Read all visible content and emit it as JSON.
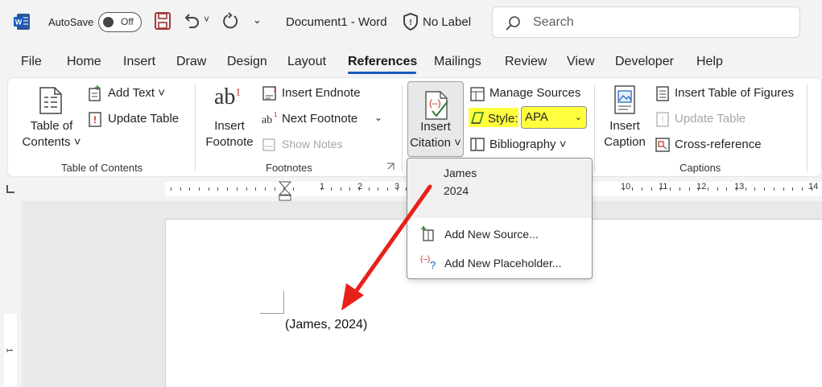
{
  "titlebar": {
    "autosave_label": "AutoSave",
    "autosave_state": "Off",
    "document_title": "Document1  -  Word",
    "label_text": "No Label",
    "search_placeholder": "Search"
  },
  "tabs": [
    "File",
    "Home",
    "Insert",
    "Draw",
    "Design",
    "Layout",
    "References",
    "Mailings",
    "Review",
    "View",
    "Developer",
    "Help"
  ],
  "active_tab": "References",
  "ribbon": {
    "toc": {
      "big_button_line1": "Table of",
      "big_button_line2": "Contents ˅",
      "add_text": "Add Text ˅",
      "update_table": "Update Table",
      "group_label": "Table of Contents"
    },
    "footnotes": {
      "insert_footnote_line1": "Insert",
      "insert_footnote_line2": "Footnote",
      "insert_endnote": "Insert Endnote",
      "next_footnote": "Next Footnote",
      "show_notes": "Show Notes",
      "group_label": "Footnotes",
      "ab_glyph": "ab",
      "sup_glyph": "1"
    },
    "citations": {
      "insert_citation_line1": "Insert",
      "insert_citation_line2": "Citation ˅",
      "manage_sources": "Manage Sources",
      "style_label": "Style:",
      "style_value": "APA",
      "bibliography": "Bibliography ˅"
    },
    "captions": {
      "insert_caption_line1": "Insert",
      "insert_caption_line2": "Caption",
      "insert_table_of_figures": "Insert Table of Figures",
      "update_table": "Update Table",
      "cross_reference": "Cross-reference",
      "group_label": "Captions"
    }
  },
  "ruler": {
    "numbers": [
      "1",
      "2",
      "3",
      "10",
      "11",
      "12",
      "13",
      "14"
    ],
    "vertical_numbers": [
      "1"
    ]
  },
  "dropdown": {
    "source_author": "James",
    "source_year": "2024",
    "add_new_source": "Add New Source...",
    "add_new_placeholder": "Add New Placeholder..."
  },
  "document": {
    "citation": "(James, 2024)"
  },
  "colors": {
    "accent": "#185abd",
    "highlight": "#ffff3d",
    "arrow": "#e8201a",
    "word_blue": "#2b579a"
  }
}
